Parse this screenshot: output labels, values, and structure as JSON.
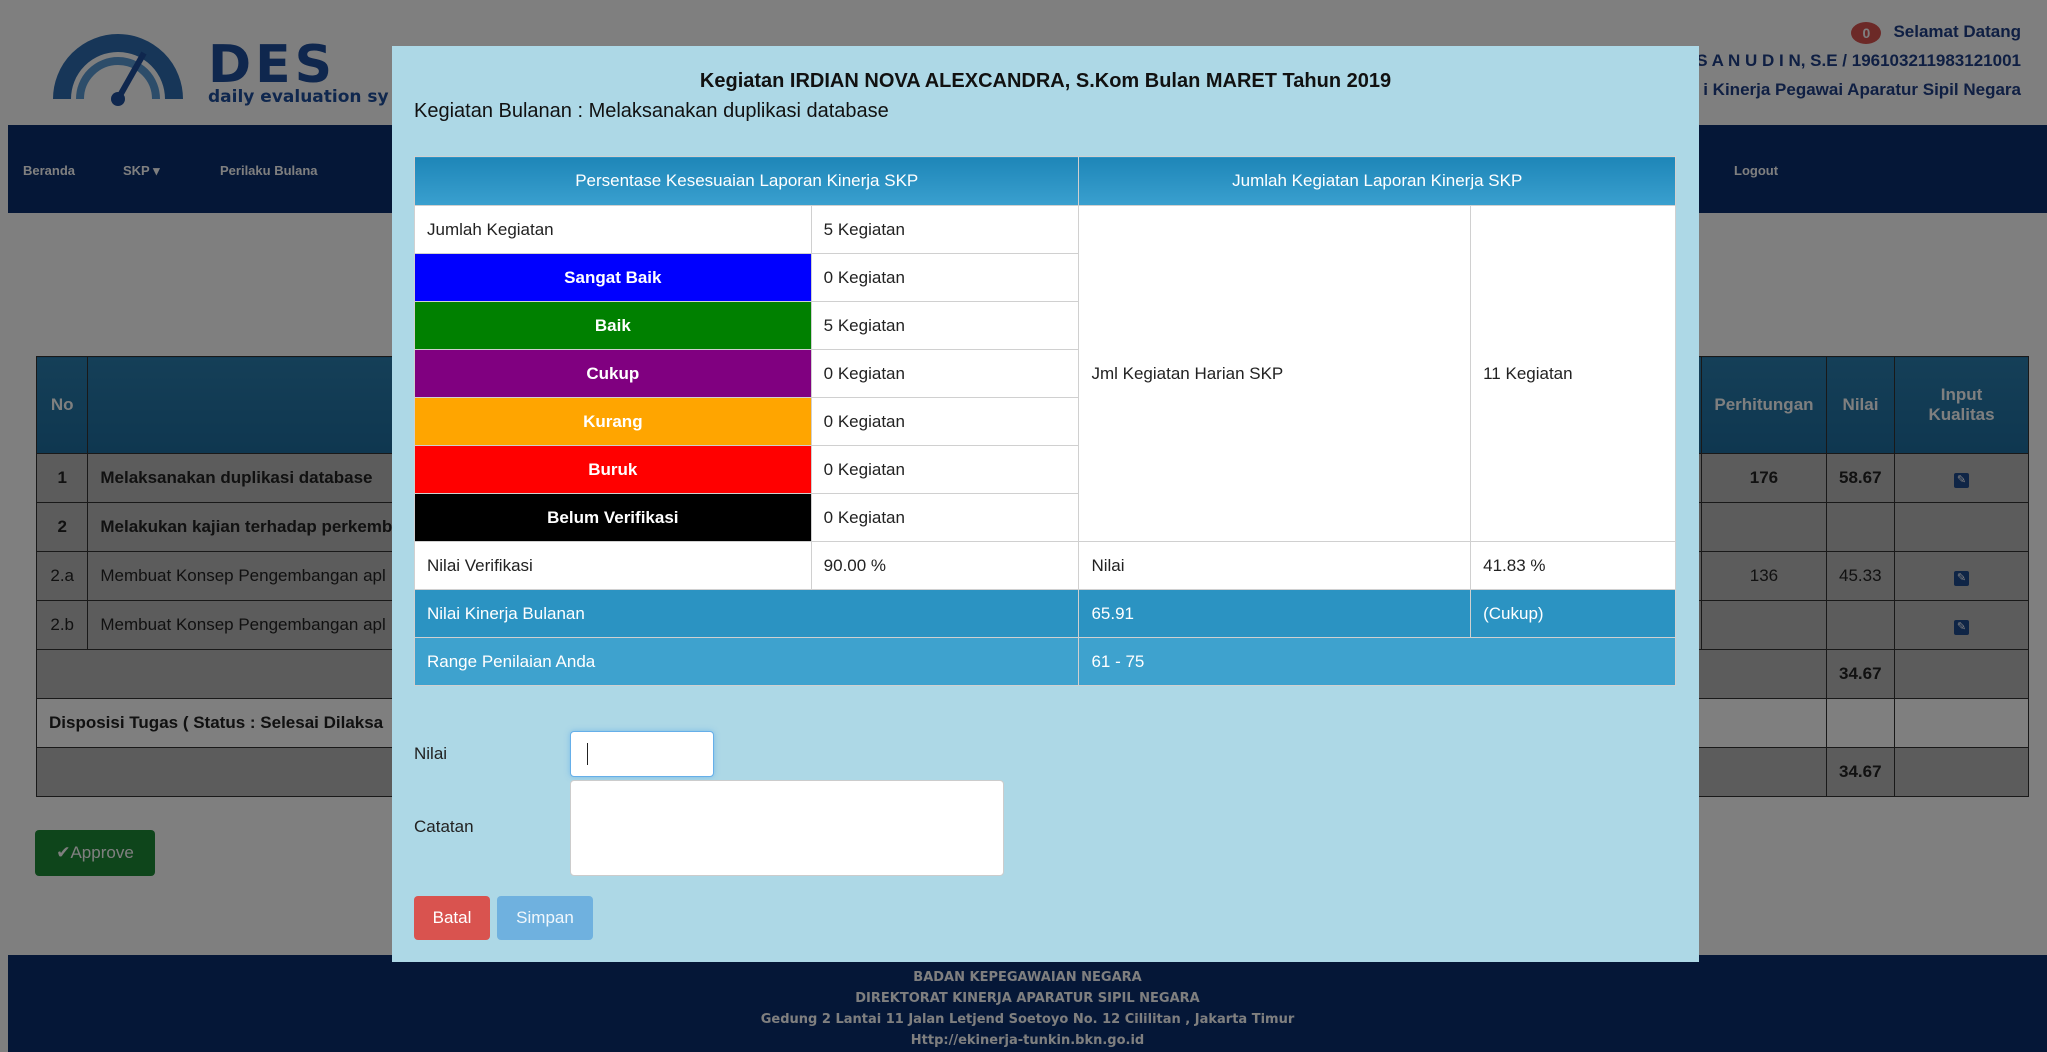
{
  "header": {
    "logo_big": "DES",
    "logo_small": "daily evaluation sy",
    "notif_count": "0",
    "welcome": "Selamat Datang",
    "user_line": "S A N U D I N, S.E / 196103211983121001",
    "agency_line": "i Kinerja Pegawai Aparatur Sipil Negara"
  },
  "nav": {
    "beranda": "Beranda",
    "skp": "SKP ▾",
    "perilaku": "Perilaku Bulana",
    "logout": "Logout"
  },
  "table": {
    "headers": {
      "no": "No",
      "perhitungan": "Perhitungan",
      "nilai": "Nilai",
      "input": "Input Kualitas"
    },
    "rows": [
      {
        "no": "1",
        "kegiatan": "Melaksanakan duplikasi database",
        "perhitungan": "176",
        "nilai": "58.67",
        "bold": true,
        "edit": true
      },
      {
        "no": "2",
        "kegiatan": "Melakukan kajian terhadap perkemb",
        "perhitungan": "",
        "nilai": "",
        "bold": true,
        "edit": false
      },
      {
        "no": "2.a",
        "kegiatan": "Membuat Konsep Pengembangan apl",
        "perhitungan": "136",
        "nilai": "45.33",
        "bold": false,
        "edit": true
      },
      {
        "no": "2.b",
        "kegiatan": "Membuat Konsep Pengembangan apl",
        "perhitungan": "",
        "nilai": "",
        "bold": false,
        "edit": true
      }
    ],
    "total1": "34.67",
    "disposisi": "Disposisi Tugas ( Status : Selesai Dilaksa",
    "total2": "34.67"
  },
  "approve_label": "✔Approve",
  "footer": {
    "line1": "BADAN KEPEGAWAIAN NEGARA",
    "line2": "DIREKTORAT KINERJA APARATUR SIPIL NEGARA",
    "line3": "Gedung 2 Lantai 11 Jalan Letjend Soetoyo No. 12 Cililitan , Jakarta Timur",
    "line4": "Http://ekinerja-tunkin.bkn.go.id"
  },
  "modal": {
    "title": "Kegiatan IRDIAN NOVA ALEXCANDRA, S.Kom Bulan MARET Tahun 2019",
    "subtitle": "Kegiatan Bulanan : Melaksanakan duplikasi database",
    "col1_header": "Persentase Kesesuaian Laporan Kinerja SKP",
    "col2_header": "Jumlah Kegiatan Laporan Kinerja SKP",
    "jumlah_label": "Jumlah Kegiatan",
    "jumlah_value": "5 Kegiatan",
    "categories": [
      {
        "label": "Sangat Baik",
        "value": "0 Kegiatan",
        "color": "#0000ff"
      },
      {
        "label": "Baik",
        "value": "5 Kegiatan",
        "color": "#008000"
      },
      {
        "label": "Cukup",
        "value": "0 Kegiatan",
        "color": "#800080"
      },
      {
        "label": "Kurang",
        "value": "0 Kegiatan",
        "color": "#ffa500"
      },
      {
        "label": "Buruk",
        "value": "0 Kegiatan",
        "color": "#ff0000"
      },
      {
        "label": "Belum Verifikasi",
        "value": "0 Kegiatan",
        "color": "#000000"
      }
    ],
    "harian_label": "Jml Kegiatan Harian SKP",
    "harian_value": "11 Kegiatan",
    "verifikasi_label": "Nilai Verifikasi",
    "verifikasi_value": "90.00 %",
    "nilai_label": "Nilai",
    "nilai_value": "41.83 %",
    "kinerja_label": "Nilai Kinerja Bulanan",
    "kinerja_value": "65.91",
    "kinerja_grade": "(Cukup)",
    "range_label": "Range Penilaian Anda",
    "range_value": "61 - 75",
    "form": {
      "nilai_label": "Nilai",
      "catatan_label": "Catatan",
      "batal": "Batal",
      "simpan": "Simpan"
    }
  }
}
